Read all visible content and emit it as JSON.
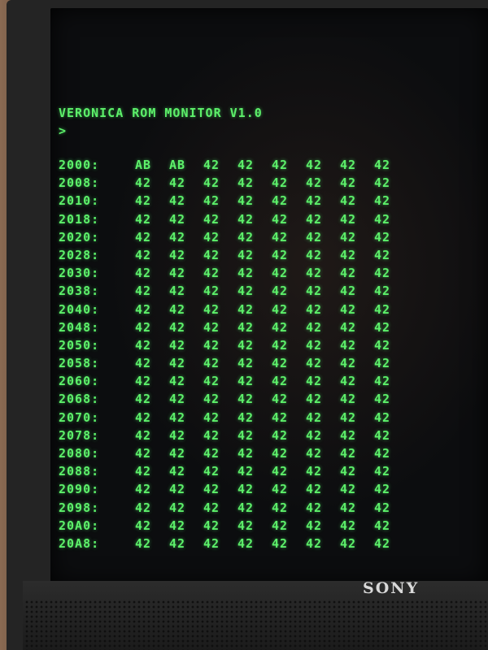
{
  "monitor": {
    "brand": "SONY"
  },
  "terminal": {
    "title": "VERONICA ROM MONITOR V1.0",
    "prompt": ">",
    "rows": [
      {
        "addr": "2000:",
        "bytes": [
          "AB",
          "AB",
          "42",
          "42",
          "42",
          "42",
          "42",
          "42"
        ]
      },
      {
        "addr": "2008:",
        "bytes": [
          "42",
          "42",
          "42",
          "42",
          "42",
          "42",
          "42",
          "42"
        ]
      },
      {
        "addr": "2010:",
        "bytes": [
          "42",
          "42",
          "42",
          "42",
          "42",
          "42",
          "42",
          "42"
        ]
      },
      {
        "addr": "2018:",
        "bytes": [
          "42",
          "42",
          "42",
          "42",
          "42",
          "42",
          "42",
          "42"
        ]
      },
      {
        "addr": "2020:",
        "bytes": [
          "42",
          "42",
          "42",
          "42",
          "42",
          "42",
          "42",
          "42"
        ]
      },
      {
        "addr": "2028:",
        "bytes": [
          "42",
          "42",
          "42",
          "42",
          "42",
          "42",
          "42",
          "42"
        ]
      },
      {
        "addr": "2030:",
        "bytes": [
          "42",
          "42",
          "42",
          "42",
          "42",
          "42",
          "42",
          "42"
        ]
      },
      {
        "addr": "2038:",
        "bytes": [
          "42",
          "42",
          "42",
          "42",
          "42",
          "42",
          "42",
          "42"
        ]
      },
      {
        "addr": "2040:",
        "bytes": [
          "42",
          "42",
          "42",
          "42",
          "42",
          "42",
          "42",
          "42"
        ]
      },
      {
        "addr": "2048:",
        "bytes": [
          "42",
          "42",
          "42",
          "42",
          "42",
          "42",
          "42",
          "42"
        ]
      },
      {
        "addr": "2050:",
        "bytes": [
          "42",
          "42",
          "42",
          "42",
          "42",
          "42",
          "42",
          "42"
        ]
      },
      {
        "addr": "2058:",
        "bytes": [
          "42",
          "42",
          "42",
          "42",
          "42",
          "42",
          "42",
          "42"
        ]
      },
      {
        "addr": "2060:",
        "bytes": [
          "42",
          "42",
          "42",
          "42",
          "42",
          "42",
          "42",
          "42"
        ]
      },
      {
        "addr": "2068:",
        "bytes": [
          "42",
          "42",
          "42",
          "42",
          "42",
          "42",
          "42",
          "42"
        ]
      },
      {
        "addr": "2070:",
        "bytes": [
          "42",
          "42",
          "42",
          "42",
          "42",
          "42",
          "42",
          "42"
        ]
      },
      {
        "addr": "2078:",
        "bytes": [
          "42",
          "42",
          "42",
          "42",
          "42",
          "42",
          "42",
          "42"
        ]
      },
      {
        "addr": "2080:",
        "bytes": [
          "42",
          "42",
          "42",
          "42",
          "42",
          "42",
          "42",
          "42"
        ]
      },
      {
        "addr": "2088:",
        "bytes": [
          "42",
          "42",
          "42",
          "42",
          "42",
          "42",
          "42",
          "42"
        ]
      },
      {
        "addr": "2090:",
        "bytes": [
          "42",
          "42",
          "42",
          "42",
          "42",
          "42",
          "42",
          "42"
        ]
      },
      {
        "addr": "2098:",
        "bytes": [
          "42",
          "42",
          "42",
          "42",
          "42",
          "42",
          "42",
          "42"
        ]
      },
      {
        "addr": "20A0:",
        "bytes": [
          "42",
          "42",
          "42",
          "42",
          "42",
          "42",
          "42",
          "42"
        ]
      },
      {
        "addr": "20A8:",
        "bytes": [
          "42",
          "42",
          "42",
          "42",
          "42",
          "42",
          "42",
          "42"
        ]
      }
    ]
  },
  "colors": {
    "phosphor": "#5df06a",
    "screen": "#0c0d0f",
    "bezel": "#242424"
  }
}
